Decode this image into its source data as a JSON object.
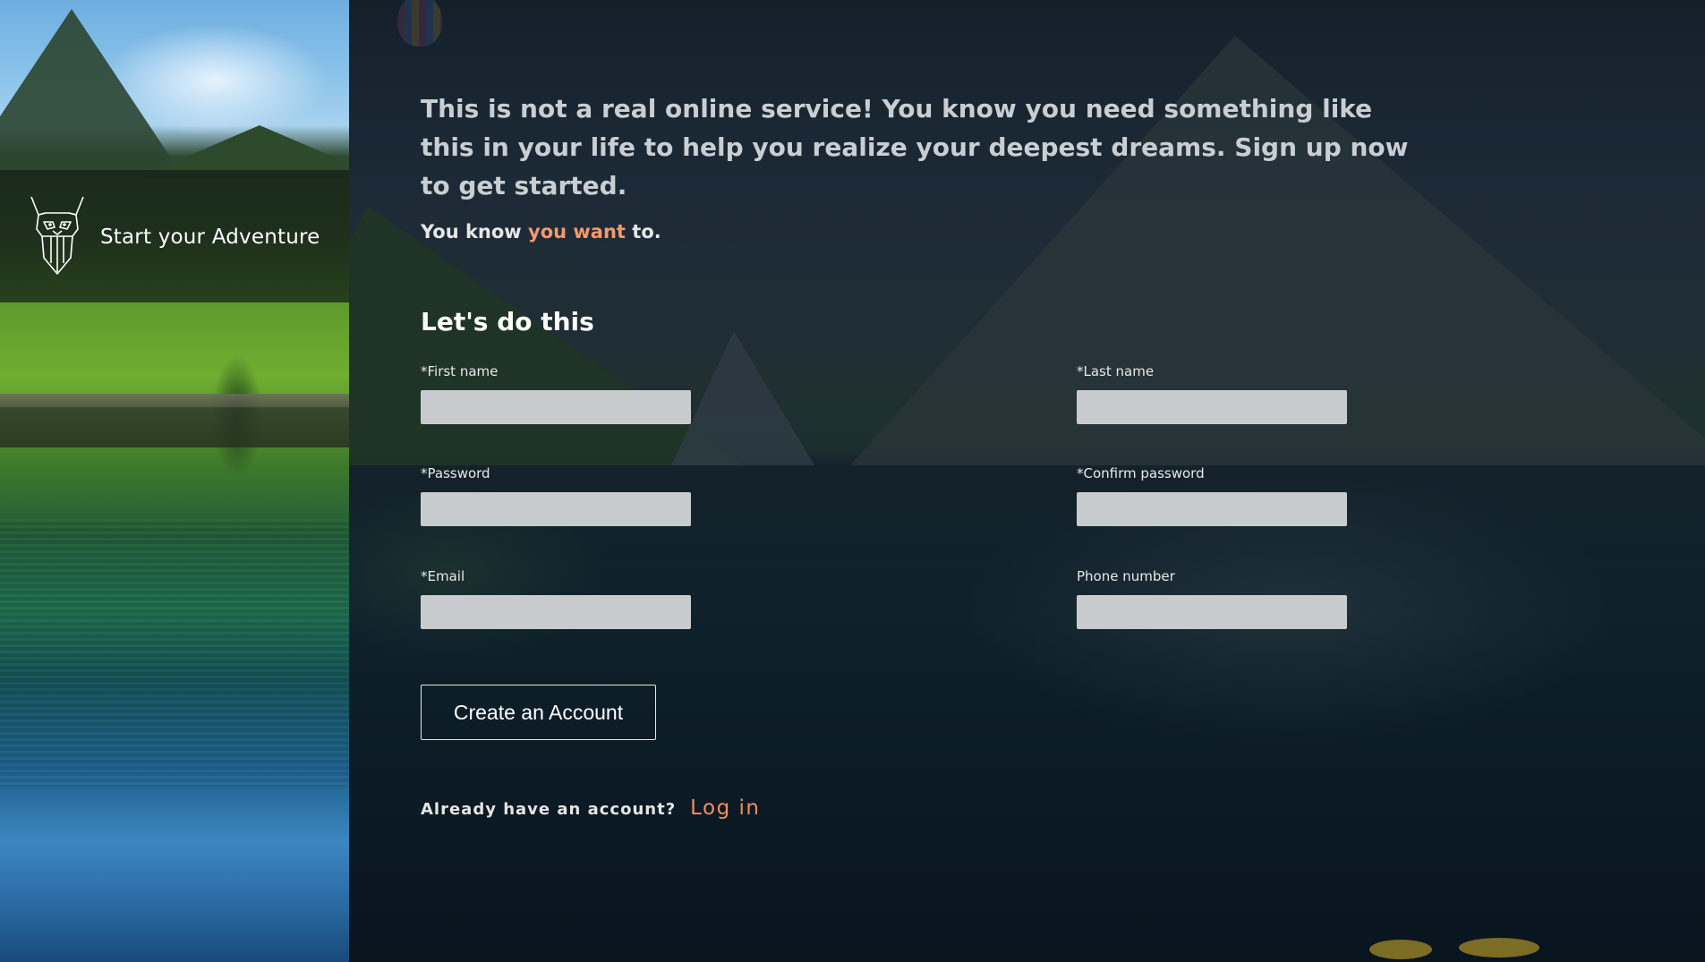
{
  "brand": {
    "title": "Start your Adventure",
    "logo_icon": "bearded-goat-logo-icon"
  },
  "intro": {
    "text": "This is not a real online service! You know you need something like this in your life to help you realize your deepest dreams. Sign up now to get started."
  },
  "tagline": {
    "before": "You know ",
    "accent": "you want",
    "after": " to."
  },
  "form": {
    "heading": "Let's do this",
    "fields": {
      "first_name": {
        "label": "*First name",
        "value": ""
      },
      "last_name": {
        "label": "*Last name",
        "value": ""
      },
      "password": {
        "label": "*Password",
        "value": ""
      },
      "confirm_password": {
        "label": "*Confirm password",
        "value": ""
      },
      "email": {
        "label": "*Email",
        "value": ""
      },
      "phone": {
        "label": "Phone number",
        "value": ""
      }
    },
    "submit_label": "Create an Account"
  },
  "login": {
    "prompt": "Already have an account?",
    "link_label": "Log in"
  },
  "colors": {
    "accent": "#f29a6c",
    "link": "#ef8f62",
    "input_bg": "#c8cbcd"
  }
}
